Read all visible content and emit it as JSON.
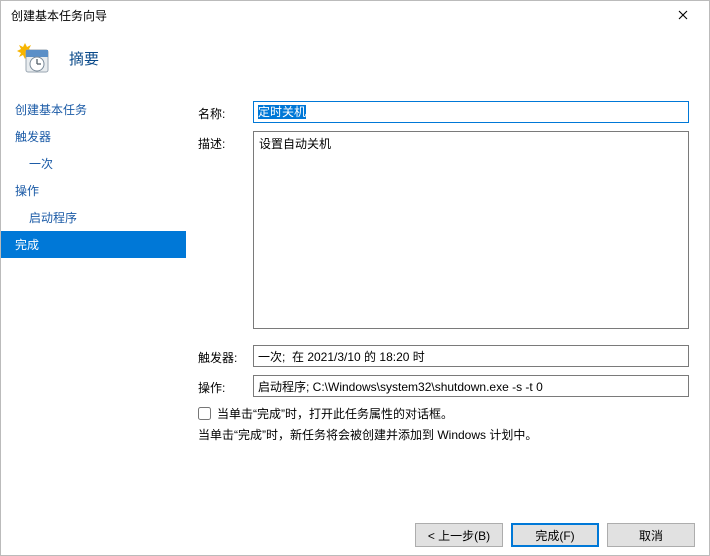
{
  "window": {
    "title": "创建基本任务向导",
    "close_icon": "close"
  },
  "header": {
    "title": "摘要"
  },
  "sidebar": {
    "items": [
      {
        "label": "创建基本任务",
        "indent": false
      },
      {
        "label": "触发器",
        "indent": false
      },
      {
        "label": "一次",
        "indent": true
      },
      {
        "label": "操作",
        "indent": false
      },
      {
        "label": "启动程序",
        "indent": true
      },
      {
        "label": "完成",
        "indent": false,
        "active": true
      }
    ]
  },
  "form": {
    "name_label": "名称:",
    "name_value": "定时关机",
    "desc_label": "描述:",
    "desc_value": "设置自动关机",
    "trigger_label": "触发器:",
    "trigger_value": "一次;  在 2021/3/10 的 18:20 时",
    "action_label": "操作:",
    "action_value": "启动程序; C:\\Windows\\system32\\shutdown.exe -s -t 0",
    "checkbox_label": "当单击“完成”时，打开此任务属性的对话框。",
    "info_text": "当单击“完成”时，新任务将会被创建并添加到 Windows 计划中。"
  },
  "buttons": {
    "back": "< 上一步(B)",
    "finish": "完成(F)",
    "cancel": "取消"
  }
}
